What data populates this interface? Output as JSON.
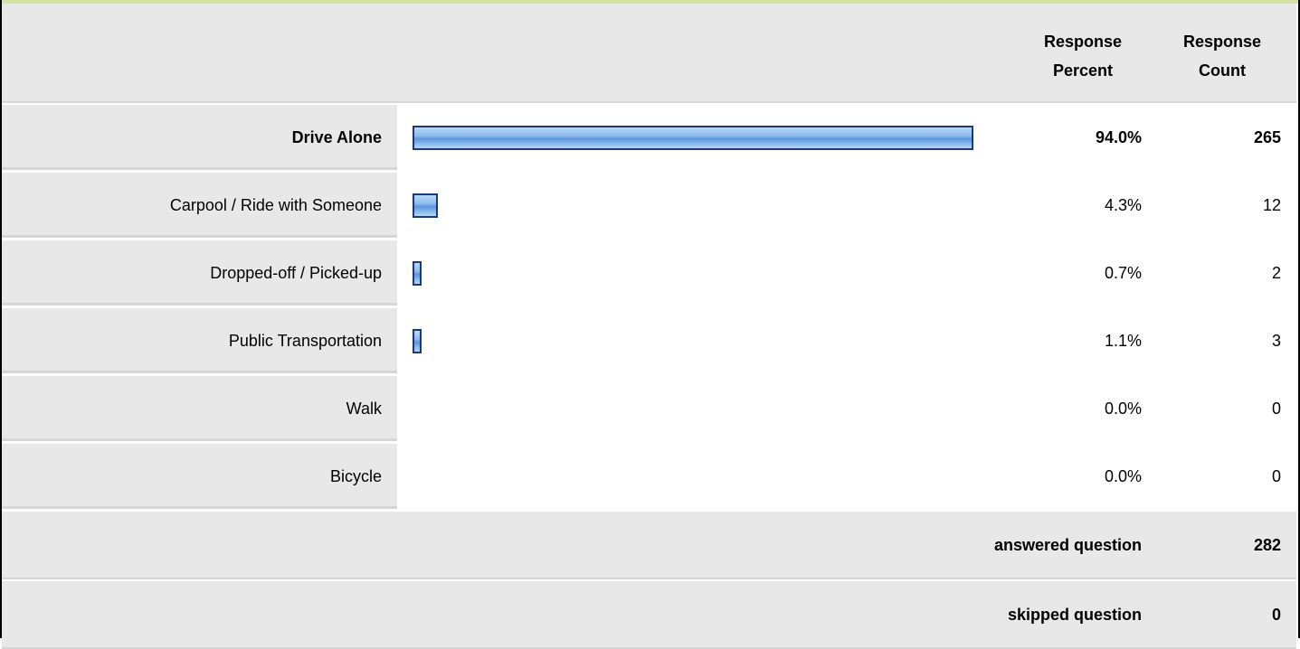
{
  "header": {
    "pct_line1": "Response",
    "pct_line2": "Percent",
    "cnt_line1": "Response",
    "cnt_line2": "Count"
  },
  "chart_data": {
    "type": "bar",
    "orientation": "horizontal",
    "categories": [
      "Drive Alone",
      "Carpool / Ride with Someone",
      "Dropped-off / Picked-up",
      "Public Transportation",
      "Walk",
      "Bicycle"
    ],
    "values": [
      94.0,
      4.3,
      0.7,
      1.1,
      0.0,
      0.0
    ],
    "xlim": [
      0,
      100
    ]
  },
  "rows": [
    {
      "label": "Drive Alone",
      "percent": "94.0%",
      "count": "265",
      "highlight": true
    },
    {
      "label": "Carpool / Ride with Someone",
      "percent": "4.3%",
      "count": "12",
      "highlight": false
    },
    {
      "label": "Dropped-off / Picked-up",
      "percent": "0.7%",
      "count": "2",
      "highlight": false
    },
    {
      "label": "Public Transportation",
      "percent": "1.1%",
      "count": "3",
      "highlight": false
    },
    {
      "label": "Walk",
      "percent": "0.0%",
      "count": "0",
      "highlight": false
    },
    {
      "label": "Bicycle",
      "percent": "0.0%",
      "count": "0",
      "highlight": false
    }
  ],
  "footer": {
    "answered_label": "answered question",
    "answered_value": "282",
    "skipped_label": "skipped question",
    "skipped_value": "0"
  },
  "colors": {
    "bar_border": "#1c3a78",
    "bar_fill": "#8dbbee",
    "row_background": "#e8e8e8",
    "top_accent": "#d3e2a0"
  }
}
